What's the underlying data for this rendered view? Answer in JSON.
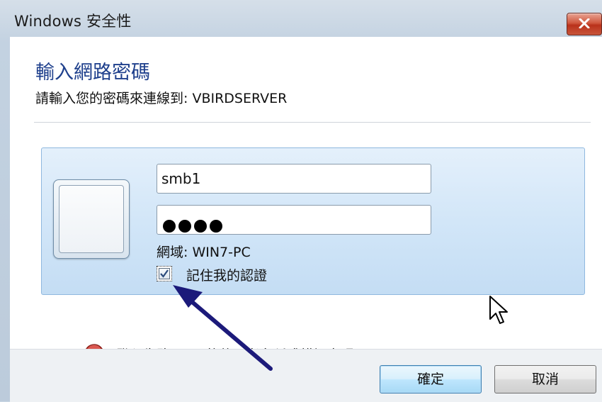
{
  "window": {
    "title": "Windows 安全性",
    "close_icon": "close-icon"
  },
  "dialog": {
    "heading": "輸入網路密碼",
    "subheading": "請輸入您的密碼來連線到: VBIRDSERVER"
  },
  "credentials": {
    "username_value": "smb1",
    "password_masked_length": 4,
    "domain_text": "網域: WIN7-PC",
    "remember_label": "記住我的認證",
    "remember_checked": true
  },
  "error": {
    "icon": "error-icon",
    "message": "登入失敗: 不明的使用者名稱或錯誤密碼。"
  },
  "buttons": {
    "ok_label": "確定",
    "cancel_label": "取消"
  },
  "colors": {
    "heading": "#1e3f8c",
    "arrow": "#1c1a7a",
    "error_icon": "#d3342b"
  }
}
